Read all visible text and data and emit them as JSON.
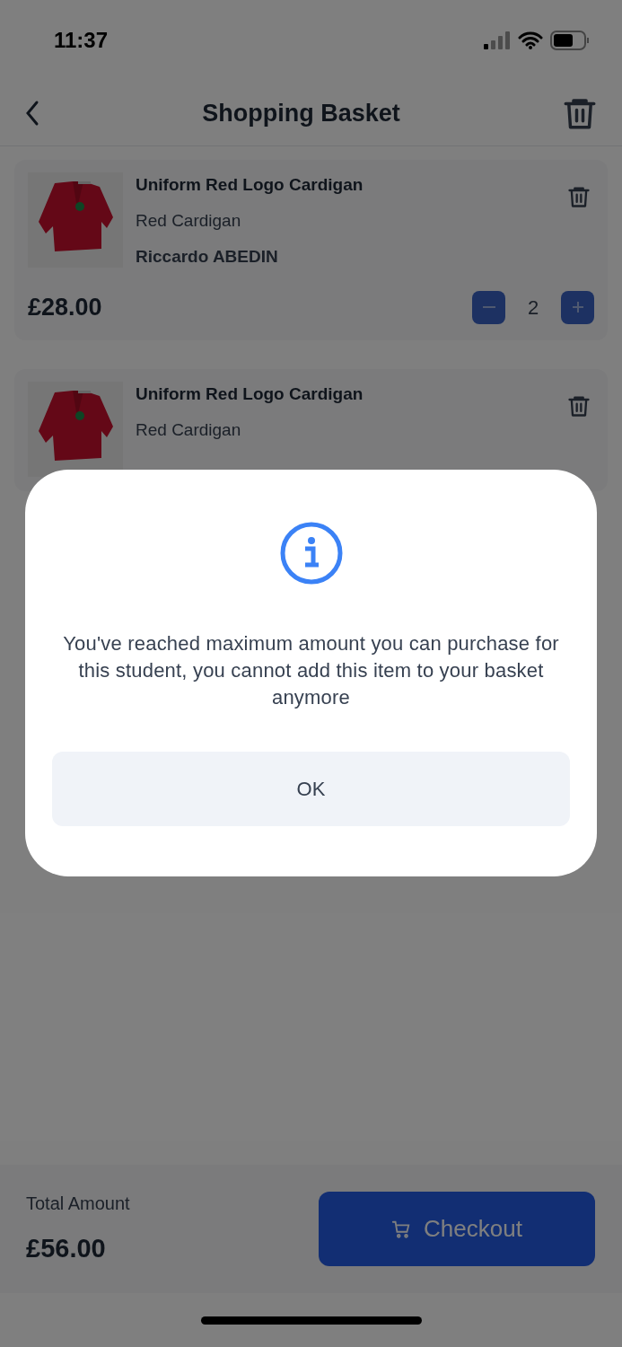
{
  "status_bar": {
    "time": "11:37"
  },
  "header": {
    "title": "Shopping Basket"
  },
  "items": [
    {
      "title": "Uniform Red Logo Cardigan",
      "variant": "Red Cardigan",
      "student": "Riccardo ABEDIN",
      "price": "£28.00",
      "quantity": "2"
    },
    {
      "title": "Uniform Red Logo Cardigan",
      "variant": "Red Cardigan"
    }
  ],
  "footer": {
    "total_label": "Total Amount",
    "total": "£56.00",
    "checkout": "Checkout"
  },
  "dialog": {
    "message": "You've reached maximum amount you can purchase for this student, you cannot add this item to your basket anymore",
    "button": "OK"
  }
}
